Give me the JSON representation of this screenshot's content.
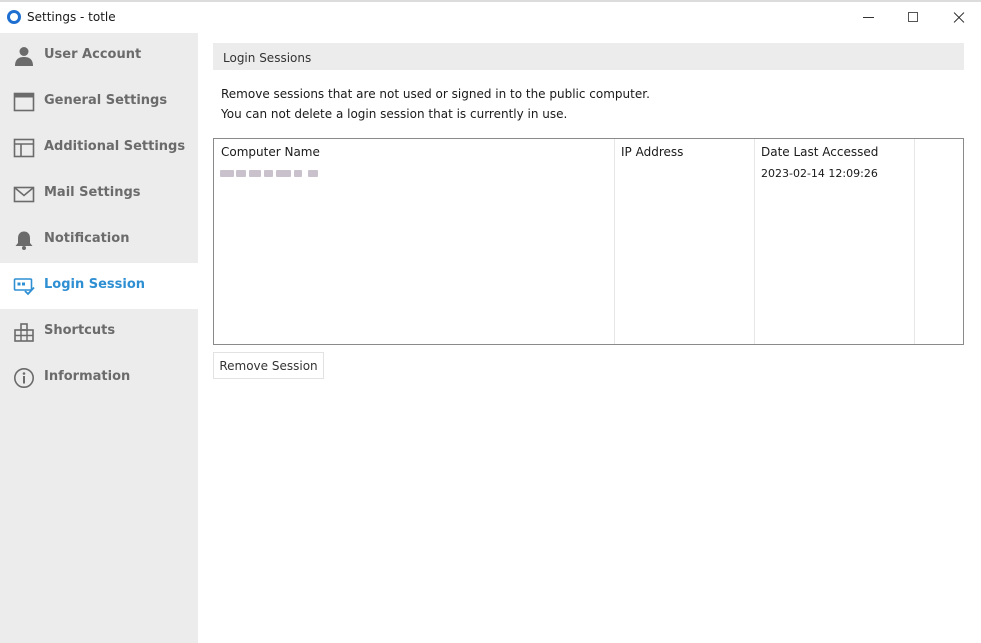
{
  "window": {
    "title": "Settings - totle"
  },
  "sidebar": {
    "items": [
      {
        "label": "User Account",
        "icon": "user-icon",
        "active": false
      },
      {
        "label": "General Settings",
        "icon": "window-icon",
        "active": false
      },
      {
        "label": "Additional Settings",
        "icon": "panel-icon",
        "active": false
      },
      {
        "label": "Mail Settings",
        "icon": "mail-icon",
        "active": false
      },
      {
        "label": "Notification",
        "icon": "bell-icon",
        "active": false
      },
      {
        "label": "Login Session",
        "icon": "login-session-icon",
        "active": true
      },
      {
        "label": "Shortcuts",
        "icon": "shortcuts-icon",
        "active": false
      },
      {
        "label": "Information",
        "icon": "info-icon",
        "active": false
      }
    ],
    "active_color": "#2f8fd3"
  },
  "main": {
    "section_title": "Login Sessions",
    "description_line1": "Remove sessions that are not used or signed in to the public computer.",
    "description_line2": "You can not delete a login session that is currently in use.",
    "table": {
      "columns": [
        "Computer Name",
        "IP Address",
        "Date Last Accessed"
      ],
      "rows": [
        {
          "computer_name": "",
          "ip_address": "",
          "date_last_accessed": "2023-02-14 12:09:26"
        }
      ]
    },
    "remove_button_label": "Remove Session"
  }
}
